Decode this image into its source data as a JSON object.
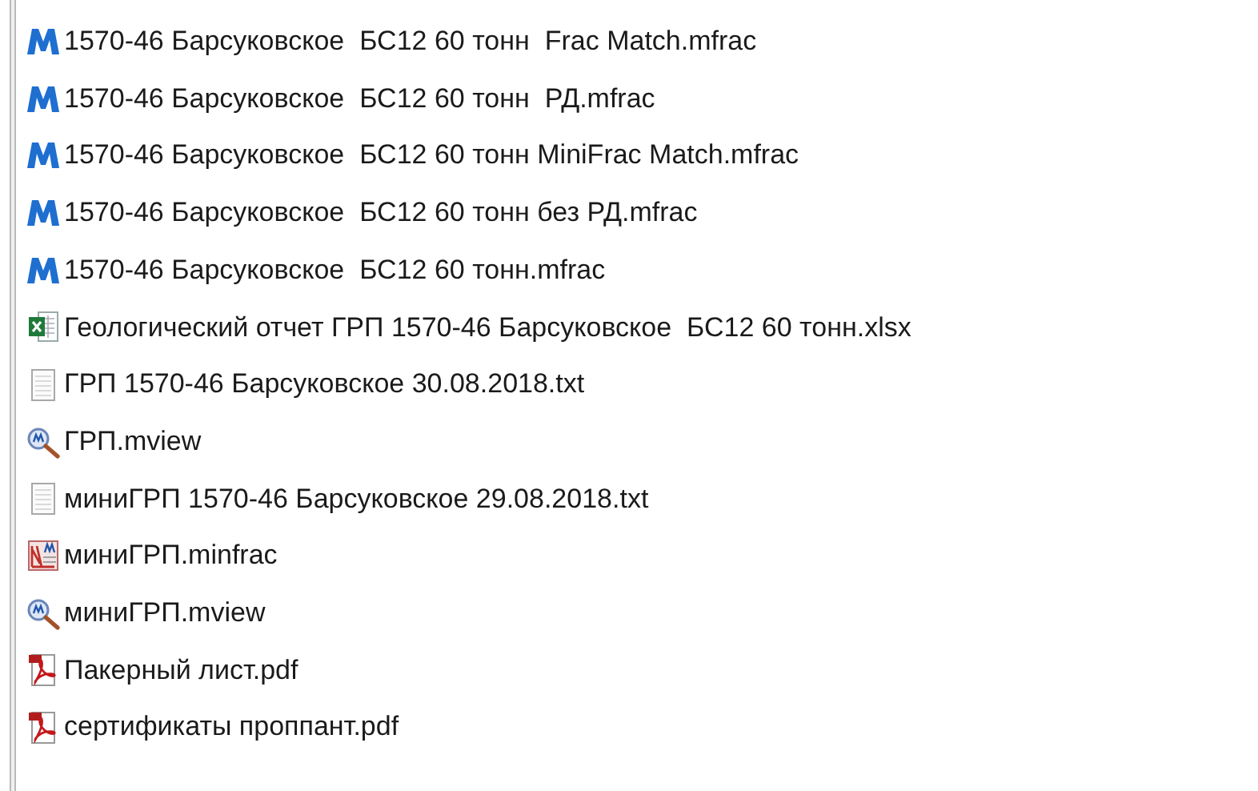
{
  "files": [
    {
      "kind": "mfrac",
      "name": "1570-46 Барсуковское  БС12 60 тонн  Frac Match.mfrac"
    },
    {
      "kind": "mfrac",
      "name": "1570-46 Барсуковское  БС12 60 тонн  РД.mfrac"
    },
    {
      "kind": "mfrac",
      "name": "1570-46 Барсуковское  БС12 60 тонн MiniFrac Match.mfrac"
    },
    {
      "kind": "mfrac",
      "name": "1570-46 Барсуковское  БС12 60 тонн без РД.mfrac"
    },
    {
      "kind": "mfrac",
      "name": "1570-46 Барсуковское  БС12 60 тонн.mfrac"
    },
    {
      "kind": "xlsx",
      "name": "Геологический отчет ГРП 1570-46 Барсуковское  БС12 60 тонн.xlsx"
    },
    {
      "kind": "txt",
      "name": "ГРП 1570-46 Барсуковское 30.08.2018.txt"
    },
    {
      "kind": "mview",
      "name": "ГРП.mview"
    },
    {
      "kind": "txt",
      "name": "миниГРП 1570-46 Барсуковское 29.08.2018.txt"
    },
    {
      "kind": "minfrac",
      "name": "миниГРП.minfrac"
    },
    {
      "kind": "mview",
      "name": "миниГРП.mview"
    },
    {
      "kind": "pdf",
      "name": "Пакерный лист.pdf"
    },
    {
      "kind": "pdf",
      "name": "сертификаты проппант.pdf"
    }
  ]
}
